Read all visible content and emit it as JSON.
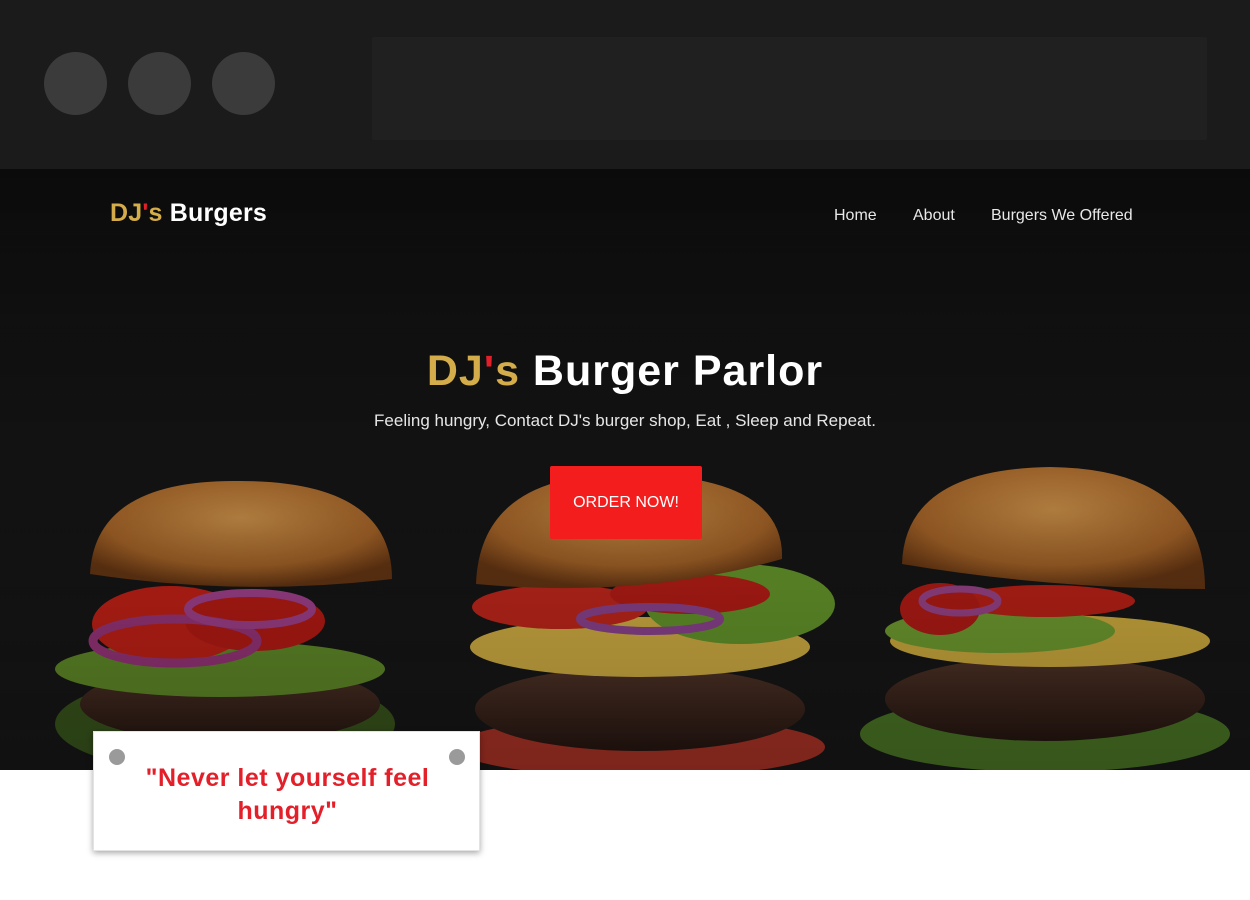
{
  "brand": {
    "part1": "DJ",
    "apostrophe": "'",
    "part2": "s",
    "rest": " Burgers"
  },
  "nav": {
    "home": "Home",
    "about": "About",
    "burgers": "Burgers We Offered"
  },
  "hero": {
    "title_part1": "DJ",
    "title_apostrophe": "'",
    "title_part2": "s",
    "title_rest": " Burger Parlor",
    "subtitle": "Feeling hungry, Contact DJ's burger shop, Eat , Sleep and Repeat.",
    "cta_label": "ORDER NOW!"
  },
  "quote": {
    "text": "\"Never let yourself feel hungry\""
  },
  "colors": {
    "gold": "#d4ad4a",
    "red": "#e3202a",
    "cta": "#f41d1d",
    "chrome": "#1b1b1b"
  }
}
